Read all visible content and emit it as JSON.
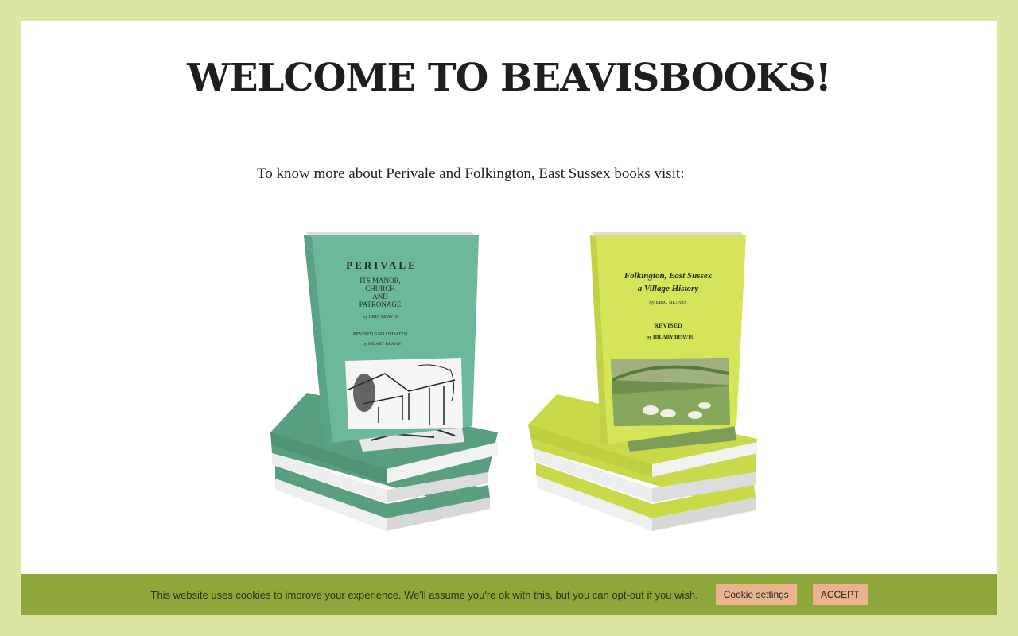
{
  "page": {
    "title": "WELCOME TO BEAVISBOOKS!",
    "intro": "To know more about Perivale and Folkington, East Sussex books visit:"
  },
  "books": [
    {
      "cover_color": "#6cb89a",
      "title_lines": [
        "PERIVALE",
        "ITS MANOR,",
        "CHURCH",
        "AND",
        "PATRONAGE"
      ],
      "author": "by ERIC BEAVIS",
      "revised": "REVISED AND UPDATED",
      "reviser": "by HILARY BEAVIS",
      "illustration": "church-sketch"
    },
    {
      "cover_color": "#d6e45a",
      "title_lines": [
        "Folkington, East Sussex",
        "a Village History"
      ],
      "author": "by ERIC BEAVIS",
      "revised": "REVISED",
      "reviser": "by HILARY BEAVIS",
      "illustration": "downs-sheep-photo"
    }
  ],
  "cookie": {
    "message": "This website uses cookies to improve your experience. We'll assume you're ok with this, but you can opt-out if you wish.",
    "settings_label": "Cookie settings",
    "accept_label": "ACCEPT",
    "bar_color": "#8ea63a",
    "button_color": "#e9b48d"
  }
}
